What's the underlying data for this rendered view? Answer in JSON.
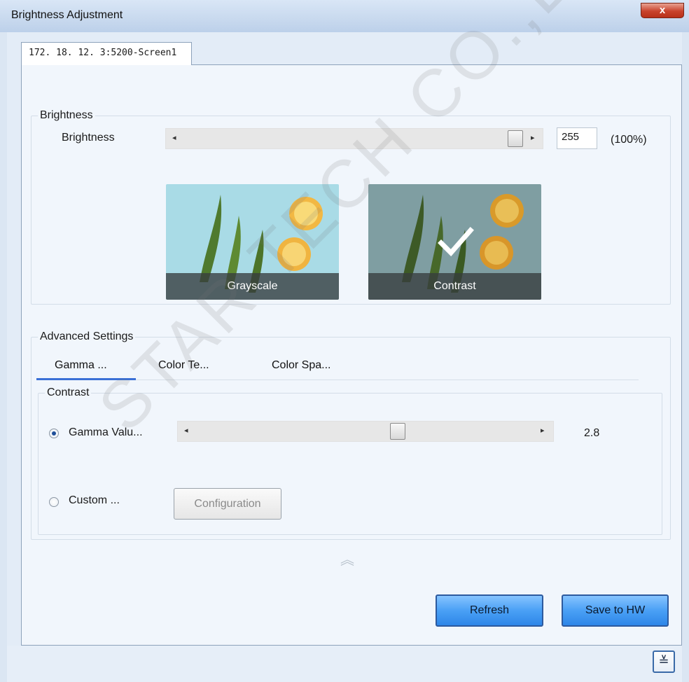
{
  "window": {
    "title": "Brightness Adjustment",
    "close_glyph": "x"
  },
  "tabs": {
    "screen_label": "172. 18. 12. 3:5200-Screen1"
  },
  "brightness": {
    "group_label": "Brightness",
    "slider_label": "Brightness",
    "value": "255",
    "percent": "(100%)",
    "slider_fraction": 1.0
  },
  "modes": [
    {
      "label": "Grayscale",
      "selected": false
    },
    {
      "label": "Contrast",
      "selected": true
    }
  ],
  "advanced": {
    "group_label": "Advanced Settings",
    "tabs": [
      "Gamma ...",
      "Color Te...",
      "Color Spa..."
    ],
    "active_tab": 0,
    "contrast_group_label": "Contrast",
    "gamma_label": "Gamma Valu...",
    "gamma_value": "2.8",
    "gamma_selected": true,
    "custom_label": "Custom ...",
    "custom_selected": false,
    "config_button": "Configuration"
  },
  "buttons": {
    "refresh": "Refresh",
    "save": "Save to HW"
  },
  "icons": {
    "close": "close-icon",
    "left_arrow": "◂",
    "right_arrow": "▸",
    "check": "check-icon",
    "collapse": "︽",
    "expand": "≚"
  },
  "colors": {
    "accent": "#3a70d6",
    "button_blue": "#4aa0f5"
  },
  "watermark": "STAR TECH CO.,LTD."
}
